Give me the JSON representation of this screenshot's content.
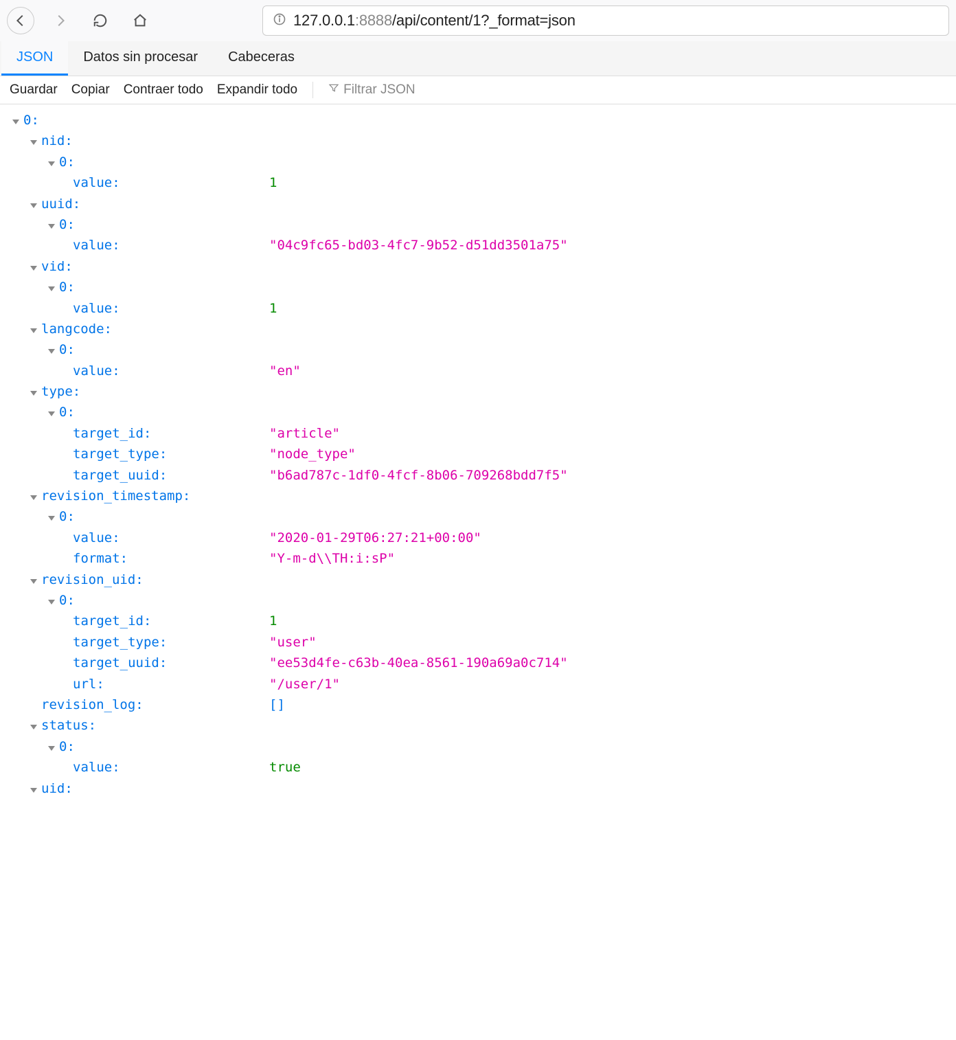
{
  "url": {
    "host": "127.0.0.1",
    "port": ":8888",
    "path": "/api/content/1?_format=json"
  },
  "tabs": {
    "json": "JSON",
    "raw": "Datos sin procesar",
    "headers": "Cabeceras"
  },
  "toolbar": {
    "save": "Guardar",
    "copy": "Copiar",
    "collapse": "Contraer todo",
    "expand": "Expandir todo",
    "filter_placeholder": "Filtrar JSON"
  },
  "tree": {
    "root_key": "0:",
    "nid_key": "nid:",
    "nid_idx": "0:",
    "nid_value_k": "value:",
    "nid_value_v": "1",
    "uuid_key": "uuid:",
    "uuid_idx": "0:",
    "uuid_value_k": "value:",
    "uuid_value_v": "\"04c9fc65-bd03-4fc7-9b52-d51dd3501a75\"",
    "vid_key": "vid:",
    "vid_idx": "0:",
    "vid_value_k": "value:",
    "vid_value_v": "1",
    "langcode_key": "langcode:",
    "langcode_idx": "0:",
    "langcode_value_k": "value:",
    "langcode_value_v": "\"en\"",
    "type_key": "type:",
    "type_idx": "0:",
    "type_target_id_k": "target_id:",
    "type_target_id_v": "\"article\"",
    "type_target_type_k": "target_type:",
    "type_target_type_v": "\"node_type\"",
    "type_target_uuid_k": "target_uuid:",
    "type_target_uuid_v": "\"b6ad787c-1df0-4fcf-8b06-709268bdd7f5\"",
    "revts_key": "revision_timestamp:",
    "revts_idx": "0:",
    "revts_value_k": "value:",
    "revts_value_v": "\"2020-01-29T06:27:21+00:00\"",
    "revts_format_k": "format:",
    "revts_format_v": "\"Y-m-d\\\\TH:i:sP\"",
    "revuid_key": "revision_uid:",
    "revuid_idx": "0:",
    "revuid_target_id_k": "target_id:",
    "revuid_target_id_v": "1",
    "revuid_target_type_k": "target_type:",
    "revuid_target_type_v": "\"user\"",
    "revuid_target_uuid_k": "target_uuid:",
    "revuid_target_uuid_v": "\"ee53d4fe-c63b-40ea-8561-190a69a0c714\"",
    "revuid_url_k": "url:",
    "revuid_url_v": "\"/user/1\"",
    "revlog_key": "revision_log:",
    "revlog_v": "[]",
    "status_key": "status:",
    "status_idx": "0:",
    "status_value_k": "value:",
    "status_value_v": "true",
    "uid_key": "uid:"
  }
}
